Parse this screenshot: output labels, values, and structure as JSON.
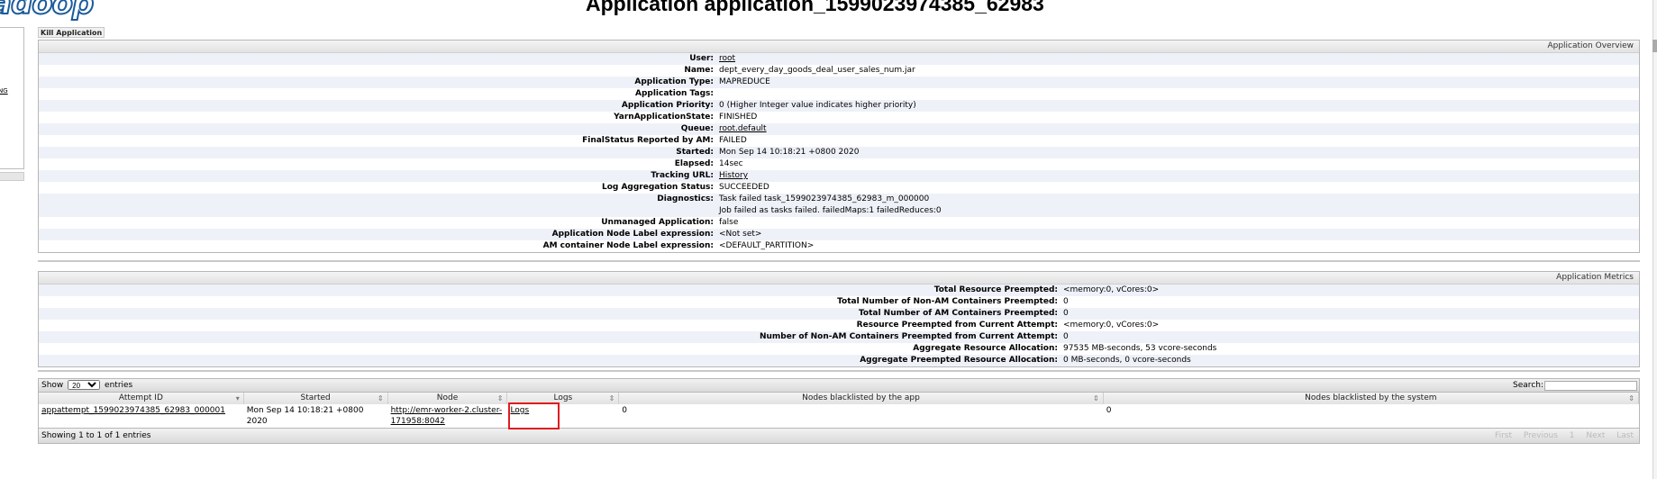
{
  "header": {
    "logo_text": "adoop",
    "page_title": "Application application_1599023974385_62983"
  },
  "nav": {
    "link": "NG"
  },
  "kill_button": "Kill Application",
  "overview": {
    "heading": "Application Overview",
    "rows": [
      {
        "label": "User:",
        "value": "root",
        "link": true
      },
      {
        "label": "Name:",
        "value": "dept_every_day_goods_deal_user_sales_num.jar"
      },
      {
        "label": "Application Type:",
        "value": "MAPREDUCE"
      },
      {
        "label": "Application Tags:",
        "value": ""
      },
      {
        "label": "Application Priority:",
        "value": "0 (Higher Integer value indicates higher priority)"
      },
      {
        "label": "YarnApplicationState:",
        "value": "FINISHED"
      },
      {
        "label": "Queue:",
        "value": "root.default",
        "link": true
      },
      {
        "label": "FinalStatus Reported by AM:",
        "value": "FAILED"
      },
      {
        "label": "Started:",
        "value": "Mon Sep 14 10:18:21 +0800 2020"
      },
      {
        "label": "Elapsed:",
        "value": "14sec"
      },
      {
        "label": "Tracking URL:",
        "value": "History",
        "link": true
      },
      {
        "label": "Log Aggregation Status:",
        "value": "SUCCEEDED"
      },
      {
        "label": "Diagnostics:",
        "value": "Task failed task_1599023974385_62983_m_000000",
        "value2": "Job failed as tasks failed. failedMaps:1 failedReduces:0"
      },
      {
        "label": "Unmanaged Application:",
        "value": "false"
      },
      {
        "label": "Application Node Label expression:",
        "value": "<Not set>"
      },
      {
        "label": "AM container Node Label expression:",
        "value": "<DEFAULT_PARTITION>"
      }
    ]
  },
  "metrics": {
    "heading": "Application Metrics",
    "rows": [
      {
        "label": "Total Resource Preempted:",
        "value": "<memory:0, vCores:0>"
      },
      {
        "label": "Total Number of Non-AM Containers Preempted:",
        "value": "0"
      },
      {
        "label": "Total Number of AM Containers Preempted:",
        "value": "0"
      },
      {
        "label": "Resource Preempted from Current Attempt:",
        "value": "<memory:0, vCores:0>"
      },
      {
        "label": "Number of Non-AM Containers Preempted from Current Attempt:",
        "value": "0"
      },
      {
        "label": "Aggregate Resource Allocation:",
        "value": "97535 MB-seconds, 53 vcore-seconds"
      },
      {
        "label": "Aggregate Preempted Resource Allocation:",
        "value": "0 MB-seconds, 0 vcore-seconds"
      }
    ]
  },
  "attempts": {
    "show_label": "Show",
    "page_size": "20",
    "entries_label": "entries",
    "search_label": "Search:",
    "search_value": "",
    "columns": [
      "Attempt ID",
      "Started",
      "Node",
      "Logs",
      "Nodes blacklisted by the app",
      "Nodes blacklisted by the system"
    ],
    "rows": [
      {
        "attempt_id": "appattempt_1599023974385_62983_000001",
        "started": "Mon Sep 14 10:18:21 +0800 2020",
        "node_line1": "http://emr-worker-2.cluster-",
        "node_line2": "171958:8042",
        "logs": "Logs",
        "blacklisted_app": "0",
        "blacklisted_system": "0"
      }
    ],
    "footer": "Showing 1 to 1 of 1 entries",
    "pager": [
      "First",
      "Previous",
      "1",
      "Next",
      "Last"
    ]
  }
}
